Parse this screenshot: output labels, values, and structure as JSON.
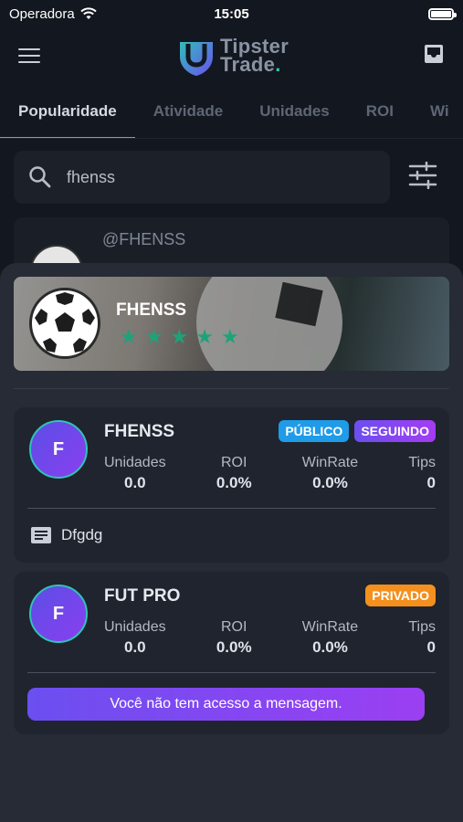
{
  "status_bar": {
    "carrier": "Operadora",
    "time": "15:05"
  },
  "header": {
    "logo_line1": "Tipster",
    "logo_line2": "Trade",
    "logo_dot": "."
  },
  "tabs": [
    {
      "label": "Popularidade",
      "active": true
    },
    {
      "label": "Atividade"
    },
    {
      "label": "Unidades"
    },
    {
      "label": "ROI"
    },
    {
      "label": "Wi"
    }
  ],
  "search": {
    "value": "fhenss",
    "placeholder": ""
  },
  "background_result": {
    "username": "@FHENSS"
  },
  "profile_banner": {
    "name": "FHENSS",
    "rating": 5
  },
  "groups": [
    {
      "initial": "F",
      "name": "FHENSS",
      "badges": [
        "PÚBLICO",
        "SEGUINDO"
      ],
      "stats": [
        {
          "label": "Unidades",
          "value": "0.0"
        },
        {
          "label": "ROI",
          "value": "0.0%"
        },
        {
          "label": "WinRate",
          "value": "0.0%"
        },
        {
          "label": "Tips",
          "value": "0"
        }
      ],
      "message": "Dfgdg"
    },
    {
      "initial": "F",
      "name": "FUT PRO",
      "badges": [
        "PRIVADO"
      ],
      "stats": [
        {
          "label": "Unidades",
          "value": "0.0"
        },
        {
          "label": "ROI",
          "value": "0.0%"
        },
        {
          "label": "WinRate",
          "value": "0.0%"
        },
        {
          "label": "Tips",
          "value": "0"
        }
      ],
      "access_button": "Você não tem acesso a mensagem."
    }
  ],
  "colors": {
    "background": "#13171f",
    "accent": "#2ec4b6",
    "badge_public": "#1f9be8",
    "badge_private": "#f4901e",
    "purple": "#7a45f0",
    "star": "#1fa27a"
  }
}
